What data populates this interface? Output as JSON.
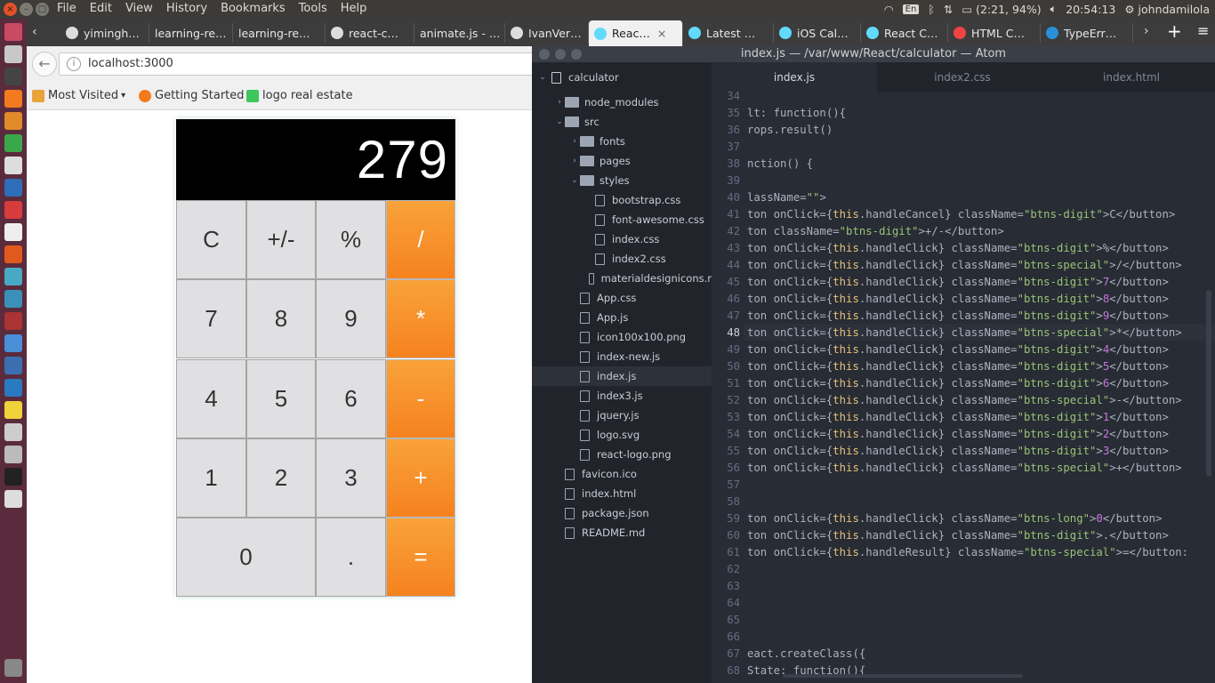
{
  "topbar": {
    "menu": [
      "File",
      "Edit",
      "View",
      "History",
      "Bookmarks",
      "Tools",
      "Help"
    ],
    "lang": "En",
    "battery": "(2:21, 94%)",
    "time": "20:54:13",
    "user": "johndamilola"
  },
  "tabs": [
    {
      "label": "yimingh…",
      "icon": "github-icon"
    },
    {
      "label": "learning-re…",
      "icon": "none"
    },
    {
      "label": "learning-re…",
      "icon": "none"
    },
    {
      "label": "react-c…",
      "icon": "github-icon"
    },
    {
      "label": "animate.js - …",
      "icon": "none"
    },
    {
      "label": "IvanVer…",
      "icon": "github-icon"
    },
    {
      "label": "Reac…",
      "icon": "react-icon"
    },
    {
      "label": "Latest …",
      "icon": "react-icon"
    },
    {
      "label": "iOS Cal…",
      "icon": "react-icon"
    },
    {
      "label": "React C…",
      "icon": "react-icon"
    },
    {
      "label": "HTML C…",
      "icon": "html-icon"
    },
    {
      "label": "TypeErr…",
      "icon": "app-icon"
    }
  ],
  "browser": {
    "url": "localhost:3000",
    "bookmarks": [
      "Most Visited",
      "Getting Started",
      "logo real estate"
    ]
  },
  "calculator": {
    "display": "279",
    "keys": [
      "C",
      "+/-",
      "%",
      "/",
      "7",
      "8",
      "9",
      "*",
      "4",
      "5",
      "6",
      "-",
      "1",
      "2",
      "3",
      "+",
      "0",
      ".",
      "="
    ]
  },
  "atom": {
    "title": "index.js — /var/www/React/calculator — Atom",
    "project": "calculator",
    "tree": [
      {
        "label": "node_modules",
        "type": "folder",
        "depth": 1,
        "arrow": "›"
      },
      {
        "label": "src",
        "type": "folder",
        "depth": 1,
        "arrow": "⌄"
      },
      {
        "label": "fonts",
        "type": "folder",
        "depth": 2,
        "arrow": "›"
      },
      {
        "label": "pages",
        "type": "folder",
        "depth": 2,
        "arrow": "›"
      },
      {
        "label": "styles",
        "type": "folder",
        "depth": 2,
        "arrow": "⌄"
      },
      {
        "label": "bootstrap.css",
        "type": "file",
        "depth": 3
      },
      {
        "label": "font-awesome.css",
        "type": "file",
        "depth": 3
      },
      {
        "label": "index.css",
        "type": "file",
        "depth": 3
      },
      {
        "label": "index2.css",
        "type": "file",
        "depth": 3
      },
      {
        "label": "materialdesignicons.r",
        "type": "file",
        "depth": 3
      },
      {
        "label": "App.css",
        "type": "file",
        "depth": 2
      },
      {
        "label": "App.js",
        "type": "file",
        "depth": 2
      },
      {
        "label": "icon100x100.png",
        "type": "file",
        "depth": 2
      },
      {
        "label": "index-new.js",
        "type": "file",
        "depth": 2
      },
      {
        "label": "index.js",
        "type": "file",
        "depth": 2,
        "selected": true
      },
      {
        "label": "index3.js",
        "type": "file",
        "depth": 2
      },
      {
        "label": "jquery.js",
        "type": "file",
        "depth": 2
      },
      {
        "label": "logo.svg",
        "type": "file",
        "depth": 2
      },
      {
        "label": "react-logo.png",
        "type": "file",
        "depth": 2
      },
      {
        "label": "favicon.ico",
        "type": "file",
        "depth": 1
      },
      {
        "label": "index.html",
        "type": "file",
        "depth": 1
      },
      {
        "label": "package.json",
        "type": "file",
        "depth": 1
      },
      {
        "label": "README.md",
        "type": "file",
        "depth": 1
      }
    ],
    "editor_tabs": [
      "index.js",
      "index2.css",
      "index.html"
    ],
    "line_numbers": [
      "34",
      "35",
      "36",
      "37",
      "38",
      "39",
      "40",
      "41",
      "42",
      "43",
      "44",
      "45",
      "46",
      "47",
      "48",
      "49",
      "50",
      "51",
      "52",
      "53",
      "54",
      "55",
      "56",
      "57",
      "58",
      "59",
      "60",
      "61",
      "62",
      "63",
      "64",
      "65",
      "66",
      "67",
      "68"
    ],
    "code": [
      {
        "n": "35",
        "parts": [
          [
            "lt: function(){",
            ""
          ]
        ]
      },
      {
        "n": "36",
        "parts": [
          [
            "rops.result()",
            ""
          ]
        ]
      },
      {
        "n": "38",
        "parts": [
          [
            "nction() {",
            ""
          ]
        ]
      },
      {
        "n": "40",
        "parts": [
          [
            "lassName=",
            ""
          ],
          [
            "\"\"",
            "s"
          ],
          [
            ">",
            ""
          ]
        ]
      },
      {
        "n": "41",
        "parts": [
          [
            "ton onClick={",
            ""
          ],
          [
            "this",
            "k"
          ],
          [
            ".handleCancel} className=",
            ""
          ],
          [
            "\"btns-digit\"",
            "s"
          ],
          [
            ">C</button>",
            ""
          ]
        ]
      },
      {
        "n": "42",
        "parts": [
          [
            "ton className=",
            ""
          ],
          [
            "\"btns-digit\"",
            "s"
          ],
          [
            ">+/-</button>",
            ""
          ]
        ]
      },
      {
        "n": "43",
        "parts": [
          [
            "ton onClick={",
            ""
          ],
          [
            "this",
            "k"
          ],
          [
            ".handleClick} className=",
            ""
          ],
          [
            "\"btns-digit\"",
            "s"
          ],
          [
            ">%</button>",
            ""
          ]
        ]
      },
      {
        "n": "44",
        "parts": [
          [
            "ton onClick={",
            ""
          ],
          [
            "this",
            "k"
          ],
          [
            ".handleClick} className=",
            ""
          ],
          [
            "\"btns-special\"",
            "s"
          ],
          [
            ">/</button>",
            ""
          ]
        ]
      },
      {
        "n": "45",
        "parts": [
          [
            "ton onClick={",
            ""
          ],
          [
            "this",
            "k"
          ],
          [
            ".handleClick} className=",
            ""
          ],
          [
            "\"btns-digit\"",
            "s"
          ],
          [
            ">",
            ""
          ],
          [
            "7",
            "p"
          ],
          [
            "</button>",
            ""
          ]
        ]
      },
      {
        "n": "46",
        "parts": [
          [
            "ton onClick={",
            ""
          ],
          [
            "this",
            "k"
          ],
          [
            ".handleClick} className=",
            ""
          ],
          [
            "\"btns-digit\"",
            "s"
          ],
          [
            ">",
            ""
          ],
          [
            "8",
            "p"
          ],
          [
            "</button>",
            ""
          ]
        ]
      },
      {
        "n": "47",
        "parts": [
          [
            "ton onClick={",
            ""
          ],
          [
            "this",
            "k"
          ],
          [
            ".handleClick} className=",
            ""
          ],
          [
            "\"btns-digit\"",
            "s"
          ],
          [
            ">",
            ""
          ],
          [
            "9",
            "p"
          ],
          [
            "</button>",
            ""
          ]
        ]
      },
      {
        "n": "48",
        "parts": [
          [
            "ton onClick={",
            ""
          ],
          [
            "this",
            "k"
          ],
          [
            ".handleClick} className=",
            ""
          ],
          [
            "\"btns-special\"",
            "s"
          ],
          [
            ">*</button>",
            ""
          ]
        ]
      },
      {
        "n": "49",
        "parts": [
          [
            "ton onClick={",
            ""
          ],
          [
            "this",
            "k"
          ],
          [
            ".handleClick} className=",
            ""
          ],
          [
            "\"btns-digit\"",
            "s"
          ],
          [
            ">",
            ""
          ],
          [
            "4",
            "p"
          ],
          [
            "</button>",
            ""
          ]
        ]
      },
      {
        "n": "50",
        "parts": [
          [
            "ton onClick={",
            ""
          ],
          [
            "this",
            "k"
          ],
          [
            ".handleClick} className=",
            ""
          ],
          [
            "\"btns-digit\"",
            "s"
          ],
          [
            ">",
            ""
          ],
          [
            "5",
            "p"
          ],
          [
            "</button>",
            ""
          ]
        ]
      },
      {
        "n": "51",
        "parts": [
          [
            "ton onClick={",
            ""
          ],
          [
            "this",
            "k"
          ],
          [
            ".handleClick} className=",
            ""
          ],
          [
            "\"btns-digit\"",
            "s"
          ],
          [
            ">",
            ""
          ],
          [
            "6",
            "p"
          ],
          [
            "</button>",
            ""
          ]
        ]
      },
      {
        "n": "52",
        "parts": [
          [
            "ton onClick={",
            ""
          ],
          [
            "this",
            "k"
          ],
          [
            ".handleClick} className=",
            ""
          ],
          [
            "\"btns-special\"",
            "s"
          ],
          [
            ">-</button>",
            ""
          ]
        ]
      },
      {
        "n": "53",
        "parts": [
          [
            "ton onClick={",
            ""
          ],
          [
            "this",
            "k"
          ],
          [
            ".handleClick} className=",
            ""
          ],
          [
            "\"btns-digit\"",
            "s"
          ],
          [
            ">",
            ""
          ],
          [
            "1",
            "p"
          ],
          [
            "</button>",
            ""
          ]
        ]
      },
      {
        "n": "54",
        "parts": [
          [
            "ton onClick={",
            ""
          ],
          [
            "this",
            "k"
          ],
          [
            ".handleClick} className=",
            ""
          ],
          [
            "\"btns-digit\"",
            "s"
          ],
          [
            ">",
            ""
          ],
          [
            "2",
            "p"
          ],
          [
            "</button>",
            ""
          ]
        ]
      },
      {
        "n": "55",
        "parts": [
          [
            "ton onClick={",
            ""
          ],
          [
            "this",
            "k"
          ],
          [
            ".handleClick} className=",
            ""
          ],
          [
            "\"btns-digit\"",
            "s"
          ],
          [
            ">",
            ""
          ],
          [
            "3",
            "p"
          ],
          [
            "</button>",
            ""
          ]
        ]
      },
      {
        "n": "56",
        "parts": [
          [
            "ton onClick={",
            ""
          ],
          [
            "this",
            "k"
          ],
          [
            ".handleClick} className=",
            ""
          ],
          [
            "\"btns-special\"",
            "s"
          ],
          [
            ">+</button>",
            ""
          ]
        ]
      },
      {
        "n": "59",
        "parts": [
          [
            "ton onClick={",
            ""
          ],
          [
            "this",
            "k"
          ],
          [
            ".handleClick} className=",
            ""
          ],
          [
            "\"btns-long\"",
            "s"
          ],
          [
            ">",
            ""
          ],
          [
            "0",
            "p"
          ],
          [
            "</button>",
            ""
          ]
        ]
      },
      {
        "n": "60",
        "parts": [
          [
            "ton onClick={",
            ""
          ],
          [
            "this",
            "k"
          ],
          [
            ".handleClick} className=",
            ""
          ],
          [
            "\"btns-digit\"",
            "s"
          ],
          [
            ">.</button>",
            ""
          ]
        ]
      },
      {
        "n": "61",
        "parts": [
          [
            "ton onClick={",
            ""
          ],
          [
            "this",
            "k"
          ],
          [
            ".handleResult} className=",
            ""
          ],
          [
            "\"btns-special\"",
            "s"
          ],
          [
            ">=</button:",
            ""
          ]
        ]
      },
      {
        "n": "67",
        "parts": [
          [
            "eact.createClass({",
            ""
          ]
        ]
      },
      {
        "n": "68",
        "parts": [
          [
            "State: function(){",
            ""
          ]
        ]
      }
    ]
  }
}
